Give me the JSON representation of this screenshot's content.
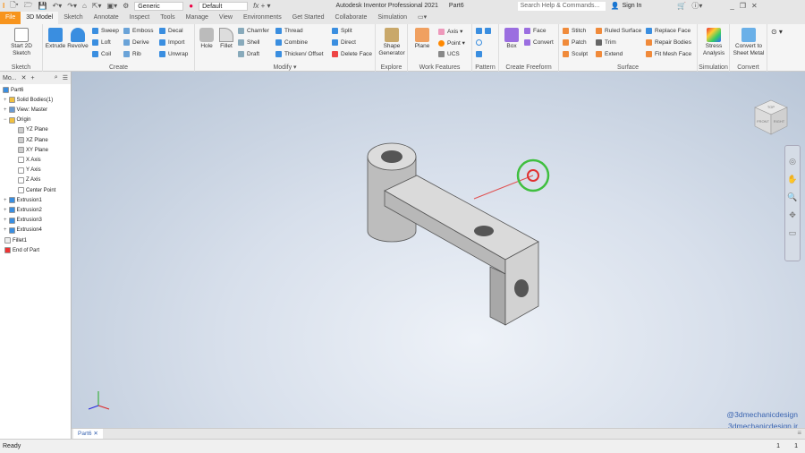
{
  "titlebar": {
    "app_title": "Autodesk Inventor Professional 2021",
    "document": "Part6",
    "material": "Generic",
    "appearance": "Default",
    "search_placeholder": "Search Help & Commands...",
    "sign_in": "Sign In"
  },
  "tabs": [
    "File",
    "3D Model",
    "Sketch",
    "Annotate",
    "Inspect",
    "Tools",
    "Manage",
    "View",
    "Environments",
    "Get Started",
    "Collaborate",
    "Simulation"
  ],
  "ribbon": {
    "sketch": {
      "label": "Sketch",
      "start": "Start 2D Sketch"
    },
    "create": {
      "label": "Create",
      "extrude": "Extrude",
      "revolve": "Revolve",
      "sweep": "Sweep",
      "loft": "Loft",
      "coil": "Coil",
      "emboss": "Emboss",
      "derive": "Derive",
      "rib": "Rib",
      "decal": "Decal",
      "import": "Import",
      "unwrap": "Unwrap"
    },
    "modify": {
      "label": "Modify ▾",
      "hole": "Hole",
      "fillet": "Fillet",
      "chamfer": "Chamfer",
      "shell": "Shell",
      "draft": "Draft",
      "thread": "Thread",
      "combine": "Combine",
      "thicken": "Thicken/ Offset",
      "split": "Split",
      "direct": "Direct",
      "delete_face": "Delete Face"
    },
    "explore": {
      "label": "Explore",
      "shape": "Shape Generator"
    },
    "work": {
      "label": "Work Features",
      "plane": "Plane",
      "axis": "Axis",
      "point": "Point",
      "ucs": "UCS"
    },
    "pattern": {
      "label": "Pattern"
    },
    "freeform": {
      "label": "Create Freeform",
      "box": "Box",
      "face": "Face",
      "convert": "Convert"
    },
    "surface": {
      "label": "Surface",
      "stitch": "Stitch",
      "patch": "Patch",
      "sculpt": "Sculpt",
      "ruled": "Ruled Surface",
      "trim": "Trim",
      "extend": "Extend",
      "replace": "Replace Face",
      "repair": "Repair Bodies",
      "fitmesh": "Fit Mesh Face"
    },
    "simulation": {
      "label": "Simulation",
      "stress": "Stress Analysis"
    },
    "convert": {
      "label": "Convert",
      "sheet": "Convert to Sheet Metal"
    }
  },
  "browser": {
    "tab": "Mo...",
    "nodes": [
      "Part6",
      "Solid Bodies(1)",
      "View: Master",
      "Origin",
      "YZ Plane",
      "XZ Plane",
      "XY Plane",
      "X Axis",
      "Y Axis",
      "Z Axis",
      "Center Point",
      "Extrusion1",
      "Extrusion2",
      "Extrusion3",
      "Extrusion4",
      "Fillet1",
      "End of Part"
    ]
  },
  "viewport": {
    "watermark1": "@3dmechanicdesign",
    "watermark2": "3dmechanicdesign.ir",
    "viewcube_front": "FRONT",
    "viewcube_right": "RIGHT",
    "viewcube_top": "TOP"
  },
  "doc_tab": "Part6",
  "status": {
    "text": "Ready",
    "count1": "1",
    "count2": "1"
  },
  "colors": {
    "accent": "#f7941d",
    "part": "#c8c8c8",
    "cursor_ring": "#3fbf3f"
  }
}
